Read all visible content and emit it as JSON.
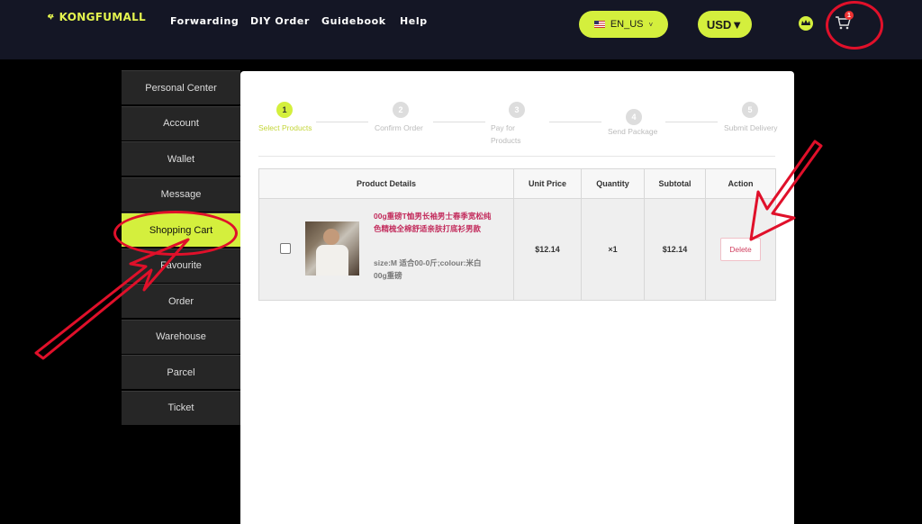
{
  "header": {
    "brand": "KONGFUMALL",
    "nav": [
      "Forwarding",
      "DIY Order",
      "Guidebook",
      "Help"
    ],
    "language": "EN_US",
    "currency": "USD▼",
    "cart_count": "1"
  },
  "sidebar": {
    "items": [
      "Personal Center",
      "Account",
      "Wallet",
      "Message",
      "Shopping Cart",
      "Favourite",
      "Order",
      "Warehouse",
      "Parcel",
      "Ticket"
    ],
    "active": "Shopping Cart"
  },
  "steps": [
    {
      "num": "1",
      "label": "Select Products"
    },
    {
      "num": "2",
      "label": "Confirm Order"
    },
    {
      "num": "3",
      "label": "Pay for Products"
    },
    {
      "num": "4",
      "label": "Send Package"
    },
    {
      "num": "5",
      "label": "Submit Delivery"
    }
  ],
  "table": {
    "headers": [
      "Product Details",
      "Unit Price",
      "Quantity",
      "Subtotal",
      "Action"
    ],
    "row": {
      "name": "00g重磅T恤男长袖男士春季宽松纯色精梳全棉舒适亲肤打底衫男款",
      "sku": "size:M 适合00-0斤;colour:米白 00g重磅",
      "unit_price": "$12.14",
      "quantity": "×1",
      "subtotal": "$12.14",
      "action": "Delete"
    }
  },
  "colors": {
    "accent": "#d4ef3d",
    "annotation": "#e0102a"
  }
}
